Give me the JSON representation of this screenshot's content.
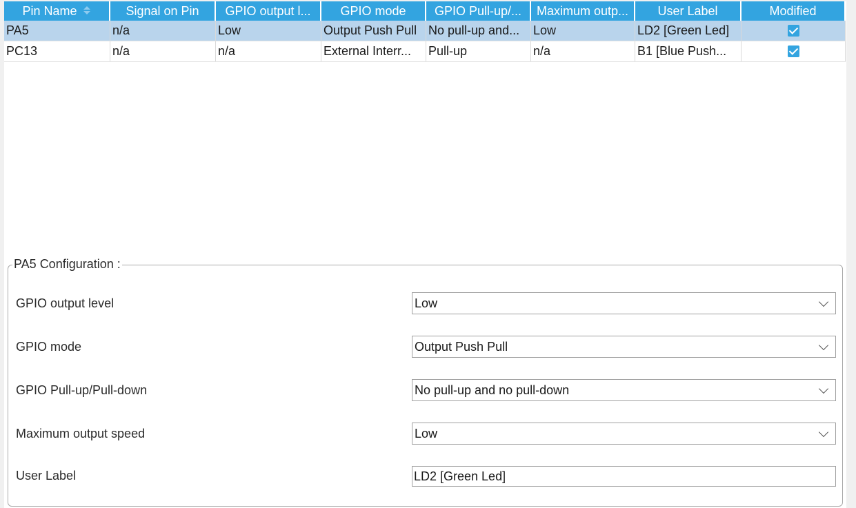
{
  "table": {
    "columns": [
      "Pin Name",
      "Signal on Pin",
      "GPIO output l...",
      "GPIO mode",
      "GPIO Pull-up/...",
      "Maximum outp...",
      "User Label",
      "Modified"
    ],
    "rows": [
      {
        "pin": "PA5",
        "signal": "n/a",
        "output_level": "Low",
        "mode": "Output Push Pull",
        "pull": "No pull-up and...",
        "speed": "Low",
        "label": "LD2 [Green Led]",
        "modified": true
      },
      {
        "pin": "PC13",
        "signal": "n/a",
        "output_level": "n/a",
        "mode": "External Interr...",
        "pull": "Pull-up",
        "speed": "n/a",
        "label": "B1 [Blue Push...",
        "modified": true
      }
    ],
    "sort_icon": "sort-updown-icon"
  },
  "config": {
    "title": "PA5 Configuration :",
    "fields": [
      {
        "label": "GPIO output level",
        "value": "Low"
      },
      {
        "label": "GPIO mode",
        "value": "Output Push Pull"
      },
      {
        "label": "GPIO Pull-up/Pull-down",
        "value": "No pull-up and no pull-down"
      },
      {
        "label": "Maximum output speed",
        "value": "Low"
      }
    ],
    "user_label": {
      "label": "User Label",
      "value": "LD2 [Green Led]"
    }
  },
  "colors": {
    "header_bg": "#33a4e0",
    "selected_row": "#b9d4ec",
    "checkbox": "#33a4e0"
  }
}
